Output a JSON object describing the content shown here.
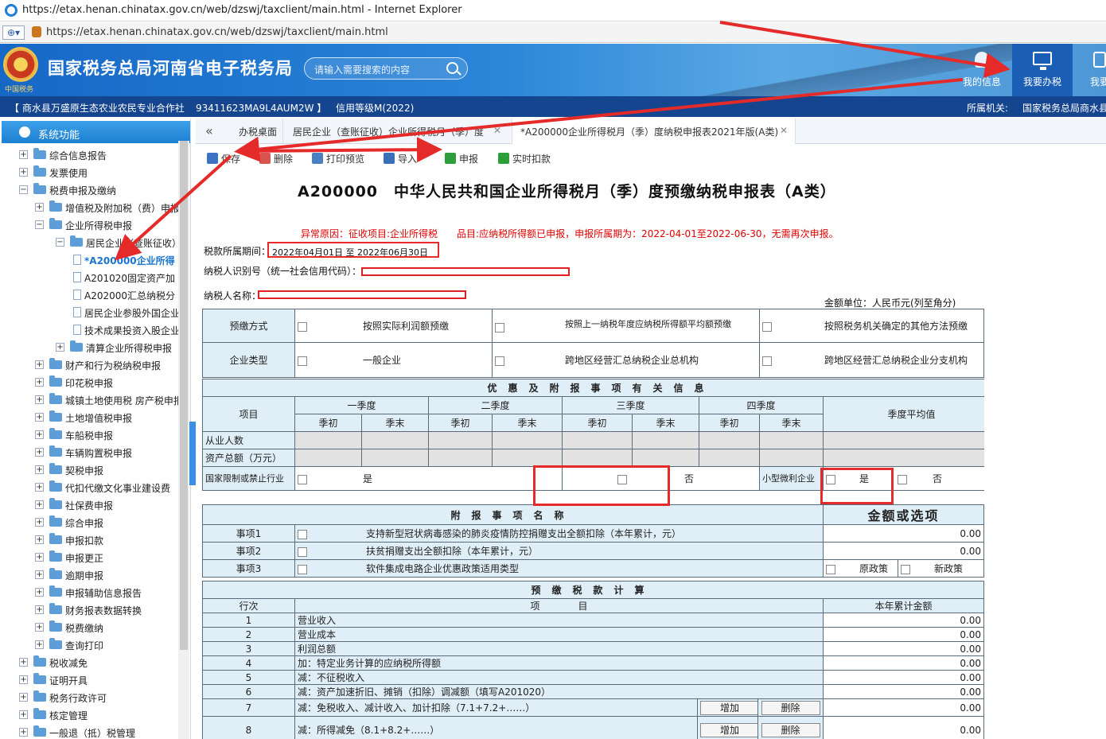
{
  "window": {
    "title": "https://etax.henan.chinatax.gov.cn/web/dzswj/taxclient/main.html - Internet Explorer",
    "address": "https://etax.henan.chinatax.gov.cn/web/dzswj/taxclient/main.html"
  },
  "header": {
    "site_title": "国家税务总局河南省电子税务局",
    "emblem_text": "中国税务",
    "search_placeholder": "请输入需要搜索的内容",
    "buttons": [
      "我的信息",
      "我要办税",
      "我要"
    ]
  },
  "infobar": {
    "company": "【 商水县万盛原生态农业农民专业合作社",
    "taxid": "93411623MA9L4AUM2W 】",
    "credit": "信用等级M(2022)",
    "authority_label": "所属机关:",
    "authority": "国家税务总局商水县"
  },
  "sidebar": {
    "title": "系统功能",
    "items": [
      {
        "label": "综合信息报告",
        "level": 1,
        "type": "folder"
      },
      {
        "label": "发票使用",
        "level": 1,
        "type": "folder"
      },
      {
        "label": "税费申报及缴纳",
        "level": 1,
        "type": "folder",
        "expanded": true
      },
      {
        "label": "增值税及附加税（费）申报",
        "level": 2,
        "type": "folder"
      },
      {
        "label": "企业所得税申报",
        "level": 2,
        "type": "folder",
        "expanded": true
      },
      {
        "label": "居民企业（查账征收）",
        "level": 3,
        "type": "folder",
        "expanded": true
      },
      {
        "label": "*A200000企业所得",
        "level": 4,
        "type": "doc",
        "active": true
      },
      {
        "label": "A201020固定资产加",
        "level": 4,
        "type": "doc"
      },
      {
        "label": "A202000汇总纳税分",
        "level": 4,
        "type": "doc"
      },
      {
        "label": "居民企业参股外国企业",
        "level": 4,
        "type": "doc"
      },
      {
        "label": "技术成果投资入股企业",
        "level": 4,
        "type": "doc"
      },
      {
        "label": "清算企业所得税申报",
        "level": 3,
        "type": "folder"
      },
      {
        "label": "财产和行为税纳税申报",
        "level": 2,
        "type": "folder"
      },
      {
        "label": "印花税申报",
        "level": 2,
        "type": "folder"
      },
      {
        "label": "城镇土地使用税 房产税申报",
        "level": 2,
        "type": "folder"
      },
      {
        "label": "土地增值税申报",
        "level": 2,
        "type": "folder"
      },
      {
        "label": "车船税申报",
        "level": 2,
        "type": "folder"
      },
      {
        "label": "车辆购置税申报",
        "level": 2,
        "type": "folder"
      },
      {
        "label": "契税申报",
        "level": 2,
        "type": "folder"
      },
      {
        "label": "代扣代缴文化事业建设费",
        "level": 2,
        "type": "folder"
      },
      {
        "label": "社保费申报",
        "level": 2,
        "type": "folder"
      },
      {
        "label": "综合申报",
        "level": 2,
        "type": "folder"
      },
      {
        "label": "申报扣款",
        "level": 2,
        "type": "folder"
      },
      {
        "label": "申报更正",
        "level": 2,
        "type": "folder"
      },
      {
        "label": "逾期申报",
        "level": 2,
        "type": "folder"
      },
      {
        "label": "申报辅助信息报告",
        "level": 2,
        "type": "folder"
      },
      {
        "label": "财务报表数据转换",
        "level": 2,
        "type": "folder"
      },
      {
        "label": "税费缴纳",
        "level": 2,
        "type": "folder"
      },
      {
        "label": "查询打印",
        "level": 2,
        "type": "folder"
      },
      {
        "label": "税收减免",
        "level": 1,
        "type": "folder"
      },
      {
        "label": "证明开具",
        "level": 1,
        "type": "folder"
      },
      {
        "label": "税务行政许可",
        "level": 1,
        "type": "folder"
      },
      {
        "label": "核定管理",
        "level": 1,
        "type": "folder"
      },
      {
        "label": "一般退（抵）税管理",
        "level": 1,
        "type": "folder"
      }
    ]
  },
  "tabs": [
    {
      "label": "办税桌面"
    },
    {
      "label": "居民企业（查账征收）企业所得税月（季）度",
      "closable": true
    },
    {
      "label": "*A200000企业所得税月（季）度纳税申报表2021年版(A类)",
      "closable": true,
      "active": true
    }
  ],
  "toolbar": [
    "保存",
    "删除",
    "打印预览",
    "导入",
    "申报",
    "实时扣款"
  ],
  "form": {
    "title": "A200000　中华人民共和国企业所得税月（季）度预缴纳税申报表（A类）",
    "warning": "异常原因：征收项目:企业所得税　　品目:应纳税所得额已申报，申报所属期为：2022-04-01至2022-06-30，无需再次申报。",
    "period_label": "税款所属期间：",
    "period_value": "2022年04月01日 至 2022年06月30日",
    "taxid_label": "纳税人识别号（统一社会信用代码）：",
    "name_label": "纳税人名称：",
    "unit": "金额单位：人民币元(列至角分)",
    "prepay_label": "预缴方式",
    "prepay_opts": [
      "按照实际利润额预缴",
      "按照上一纳税年度应纳税所得额平均额预缴",
      "按照税务机关确定的其他方法预缴"
    ],
    "ent_label": "企业类型",
    "ent_opts": [
      "一般企业",
      "跨地区经营汇总纳税企业总机构",
      "跨地区经营汇总纳税企业分支机构"
    ],
    "sec1": "优惠及附报事项有关信息",
    "item_label": "项目",
    "quarters": [
      "一季度",
      "二季度",
      "三季度",
      "四季度"
    ],
    "qb": "季初",
    "qe": "季末",
    "avg": "季度平均值",
    "employees": "从业人数",
    "assets": "资产总额（万元）",
    "restricted": "国家限制或禁止行业",
    "yes": "是",
    "no": "否",
    "small": "小型微利企业",
    "sec2": "附报事项名称",
    "sec2b": "金额或选项",
    "matters": [
      {
        "label": "事项1",
        "desc": "支持新型冠状病毒感染的肺炎疫情防控捐赠支出全额扣除（本年累计，元）",
        "val": "0.00"
      },
      {
        "label": "事项2",
        "desc": "扶贫捐赠支出全额扣除（本年累计，元）",
        "val": "0.00"
      },
      {
        "label": "事项3",
        "desc": "软件集成电路企业优惠政策适用类型",
        "o1": "原政策",
        "o2": "新政策"
      }
    ],
    "sec3": "预缴税款计算",
    "col_row": "行次",
    "col_item": "项　　　　目",
    "col_amt": "本年累计金额",
    "rows": [
      {
        "n": "1",
        "t": "营业收入",
        "v": "0.00"
      },
      {
        "n": "2",
        "t": "营业成本",
        "v": "0.00"
      },
      {
        "n": "3",
        "t": "利润总额",
        "v": "0.00"
      },
      {
        "n": "4",
        "t": "加：特定业务计算的应纳税所得额",
        "v": "0.00"
      },
      {
        "n": "5",
        "t": "减：不征税收入",
        "v": "0.00"
      },
      {
        "n": "6",
        "t": "减：资产加速折旧、摊销（扣除）调减额（填写A201020）",
        "v": "0.00"
      },
      {
        "n": "7",
        "t": "减：免税收入、减计收入、加计扣除（7.1+7.2+……）",
        "v": "0.00",
        "btns": true
      },
      {
        "n": "8",
        "t": "减：所得减免（8.1+8.2+……）",
        "v": "0.00",
        "btns": true
      }
    ],
    "add": "增加",
    "del": "删除"
  }
}
